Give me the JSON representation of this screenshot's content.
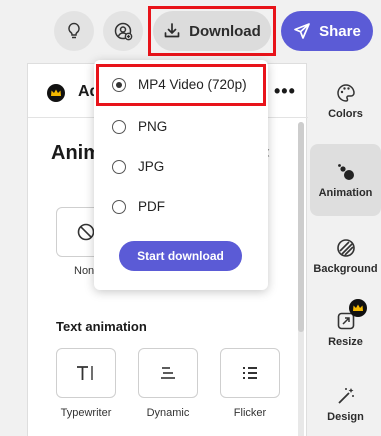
{
  "topbar": {
    "download_label": "Download",
    "share_label": "Share",
    "icons": [
      "lightbulb-icon",
      "add-user-icon",
      "download-icon",
      "share-icon"
    ]
  },
  "panel": {
    "ad_label": "Ad",
    "title": "Anim",
    "none_label": "None",
    "text_animation_title": "Text animation",
    "tiles": [
      {
        "label": "Typewriter",
        "icon": "typewriter-icon"
      },
      {
        "label": "Dynamic",
        "icon": "dynamic-icon"
      },
      {
        "label": "Flicker",
        "icon": "flicker-icon"
      }
    ]
  },
  "dropdown": {
    "options": [
      {
        "label": "MP4 Video (720p)",
        "selected": true
      },
      {
        "label": "PNG",
        "selected": false
      },
      {
        "label": "JPG",
        "selected": false
      },
      {
        "label": "PDF",
        "selected": false
      }
    ],
    "start_label": "Start download"
  },
  "rail": {
    "items": [
      {
        "label": "Colors",
        "icon": "palette-icon",
        "active": false
      },
      {
        "label": "Animation",
        "icon": "animation-icon",
        "active": true
      },
      {
        "label": "Background",
        "icon": "background-icon",
        "active": false
      },
      {
        "label": "Resize",
        "icon": "resize-icon",
        "active": false
      },
      {
        "label": "Design",
        "icon": "design-icon",
        "active": false
      }
    ]
  },
  "colors": {
    "accent": "#5b5bd6",
    "highlight": "#e8131a",
    "premium": "#111111",
    "crown": "#f5b800"
  }
}
